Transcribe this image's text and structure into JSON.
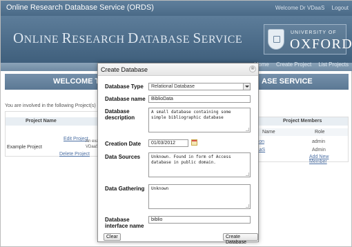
{
  "top_bar": {
    "title": "Online Research Database Service (ORDS)",
    "welcome": "Welcome Dr VDaaS",
    "logout": "Logout"
  },
  "banner": {
    "title_first_o": "O",
    "title_nline": "NLINE ",
    "title_r": "R",
    "title_esearch": "ESEARCH ",
    "title_d": "D",
    "title_atabase": "ATABASE ",
    "title_s": "S",
    "title_ervice": "ERVICE",
    "uni_line1": "UNIVERSITY OF",
    "uni_line2": "OXFORD"
  },
  "nav": {
    "home": "Home",
    "create_project": "Create Project",
    "list_projects": "List Projects"
  },
  "welcome_bar": {
    "left": "WELCOME TO",
    "right": "ASE SERVICE"
  },
  "background": {
    "involved_text": "You are involved in the following Project(s)",
    "projects_header": "Project Name",
    "project_name": "Example Project",
    "edit_project": "Edit Project",
    "delete_project": "Delete Project",
    "description_fragment": "An exam",
    "owner_fragment": "VDaaS",
    "members_header": "Project Members",
    "name_col": "Name",
    "role_col": "Role",
    "member1": "Wilson",
    "member1_role": "admin",
    "member2": "VDaaS",
    "member2_role": "Admin",
    "add_member": "Add New Member"
  },
  "modal": {
    "title": "Create Database",
    "close_icon": "⊗",
    "database_type_label": "Database Type",
    "database_type_value": "Relational Database",
    "database_name_label": "Database name",
    "database_name_value": "BiblioData",
    "database_description_label_1": "Database",
    "database_description_label_2": "description",
    "database_description_value": "A small database containing some simple bibliographic database",
    "creation_date_label": "Creation Date",
    "creation_date_value": "01/03/2012",
    "data_sources_label": "Data Sources",
    "data_sources_value": "Unknown. Found in form of Access database in public domain.",
    "data_gathering_label": "Data Gathering",
    "data_gathering_value": "Unknown",
    "interface_name_label_1": "Database",
    "interface_name_label_2": "interface name",
    "interface_name_value": "biblio",
    "clear_button": "Clear",
    "create_button": "Create Database"
  }
}
